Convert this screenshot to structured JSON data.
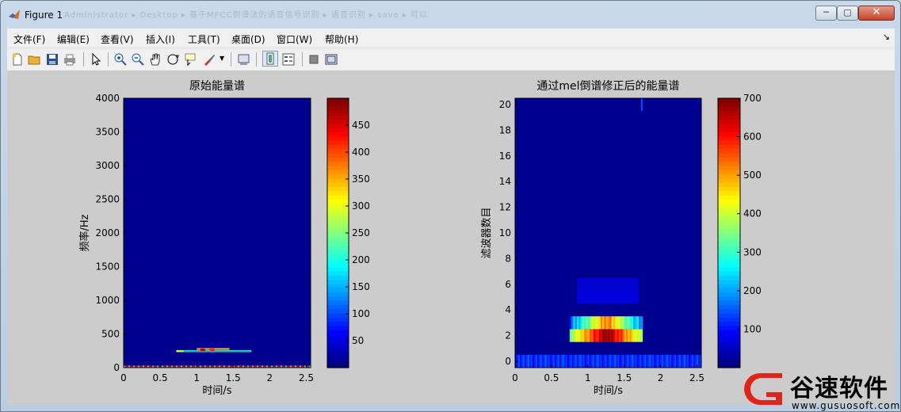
{
  "window": {
    "title": "Figure 1",
    "title_blur": "Administrator ▸ Desktop ▸ 基于MFCC倒谱法的语音信号识别 ▸ 语音识别 ▸ save ▸ 可以",
    "minimize_glyph": "─",
    "maximize_glyph": "▢",
    "close_glyph": "✕"
  },
  "menu": {
    "items": [
      "文件(F)",
      "编辑(E)",
      "查看(V)",
      "插入(I)",
      "工具(T)",
      "桌面(D)",
      "窗口(W)",
      "帮助(H)"
    ],
    "extra": "↘"
  },
  "toolbar": {
    "icons": [
      "new-figure-icon",
      "open-file-icon",
      "save-figure-icon",
      "print-figure-icon",
      "edit-plot-icon",
      "zoom-in-icon",
      "zoom-out-icon",
      "pan-icon",
      "rotate-3d-icon",
      "data-cursor-icon",
      "brush-icon",
      "link-plot-icon",
      "colorbar-icon",
      "legend-icon",
      "hide-plot-tools-icon",
      "show-plot-tools-icon"
    ]
  },
  "chart_data": [
    {
      "type": "heatmap",
      "title": "原始能量谱",
      "xlabel": "时间/s",
      "ylabel": "频率/Hz",
      "xlim": [
        0,
        2.56
      ],
      "ylim": [
        0,
        4000
      ],
      "xticks": [
        "0",
        "0.5",
        "1",
        "1.5",
        "2",
        "2.5"
      ],
      "yticks": [
        "0",
        "500",
        "1000",
        "1500",
        "2000",
        "2500",
        "3000",
        "3500",
        "4000"
      ],
      "colorbar": {
        "min": 0,
        "max": 500,
        "ticks": [
          "50",
          "100",
          "150",
          "200",
          "250",
          "300",
          "350",
          "400",
          "450"
        ]
      },
      "features": [
        {
          "x": [
            0,
            2.56
          ],
          "y": [
            0,
            30
          ],
          "value": 450,
          "note_visible": false
        },
        {
          "x": [
            0.75,
            1.75
          ],
          "y": [
            230,
            280
          ],
          "value": 250
        }
      ]
    },
    {
      "type": "heatmap",
      "title": "通过mel倒谱修正后的能量谱",
      "xlabel": "时间/s",
      "ylabel": "滤波器数目",
      "xlim": [
        0,
        2.56
      ],
      "ylim": [
        -0.5,
        20.5
      ],
      "xticks": [
        "0",
        "0.5",
        "1",
        "1.5",
        "2",
        "2.5"
      ],
      "yticks": [
        "0",
        "2",
        "4",
        "6",
        "8",
        "10",
        "12",
        "14",
        "16",
        "18",
        "20"
      ],
      "colorbar": {
        "min": 0,
        "max": 700,
        "ticks": [
          "100",
          "200",
          "300",
          "400",
          "500",
          "600",
          "700"
        ]
      },
      "features": [
        {
          "x": [
            0,
            2.56
          ],
          "y": [
            -0.5,
            0.5
          ],
          "value": 60
        },
        {
          "x": [
            0.75,
            1.75
          ],
          "y": [
            1.5,
            2.5
          ],
          "value": 450
        },
        {
          "x": [
            0.75,
            1.75
          ],
          "y": [
            2.5,
            3.5
          ],
          "value": 250
        }
      ]
    }
  ],
  "watermark": {
    "text": "谷速软件",
    "url": "www.gusuosoft.com"
  },
  "colors": {
    "jet_dark_blue": "#00008f",
    "figure_bg": "#cccccc"
  }
}
